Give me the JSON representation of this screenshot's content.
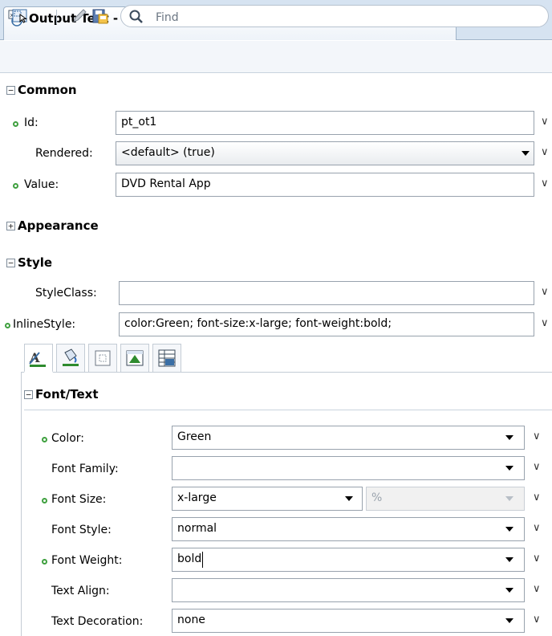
{
  "tab": {
    "title": "Output Text - DVD Rental App - Property Inspector",
    "close_glyph": "×"
  },
  "toolbar": {
    "find_placeholder": "Find",
    "icons": [
      "select-component-icon",
      "edit-pencil-icon",
      "save-icon",
      "search-icon"
    ]
  },
  "sections": {
    "common": {
      "label": "Common",
      "toggle": "−"
    },
    "appearance": {
      "label": "Appearance",
      "toggle": "+"
    },
    "style": {
      "label": "Style",
      "toggle": "−"
    }
  },
  "common_fields": {
    "id": {
      "label": "Id:",
      "value": "pt_ot1"
    },
    "rendered": {
      "label": "Rendered:",
      "value": "<default> (true)"
    },
    "value": {
      "label": "Value:",
      "value": "DVD Rental App"
    }
  },
  "style_fields": {
    "styleclass": {
      "label": "StyleClass:",
      "value": ""
    },
    "inlinestyle": {
      "label": "InlineStyle:",
      "value": "color:Green; font-size:x-large; font-weight:bold;"
    }
  },
  "font_text": {
    "header": "Font/Text",
    "toggle": "−",
    "color": {
      "label": "Color:",
      "value": "Green"
    },
    "font_family": {
      "label": "Font Family:",
      "value": ""
    },
    "font_size": {
      "label": "Font Size:",
      "value": "x-large",
      "unit": "%"
    },
    "font_style": {
      "label": "Font Style:",
      "value": "normal"
    },
    "font_weight": {
      "label": "Font Weight:",
      "value": "bold"
    },
    "text_align": {
      "label": "Text Align:",
      "value": ""
    },
    "text_decoration": {
      "label": "Text Decoration:",
      "value": "none"
    }
  },
  "chevron_glyph": "∨",
  "colors": {
    "set_dot": "#3fa03f",
    "tab_strip": "#d6e3f1",
    "toolbar": "#f3f6fa"
  }
}
